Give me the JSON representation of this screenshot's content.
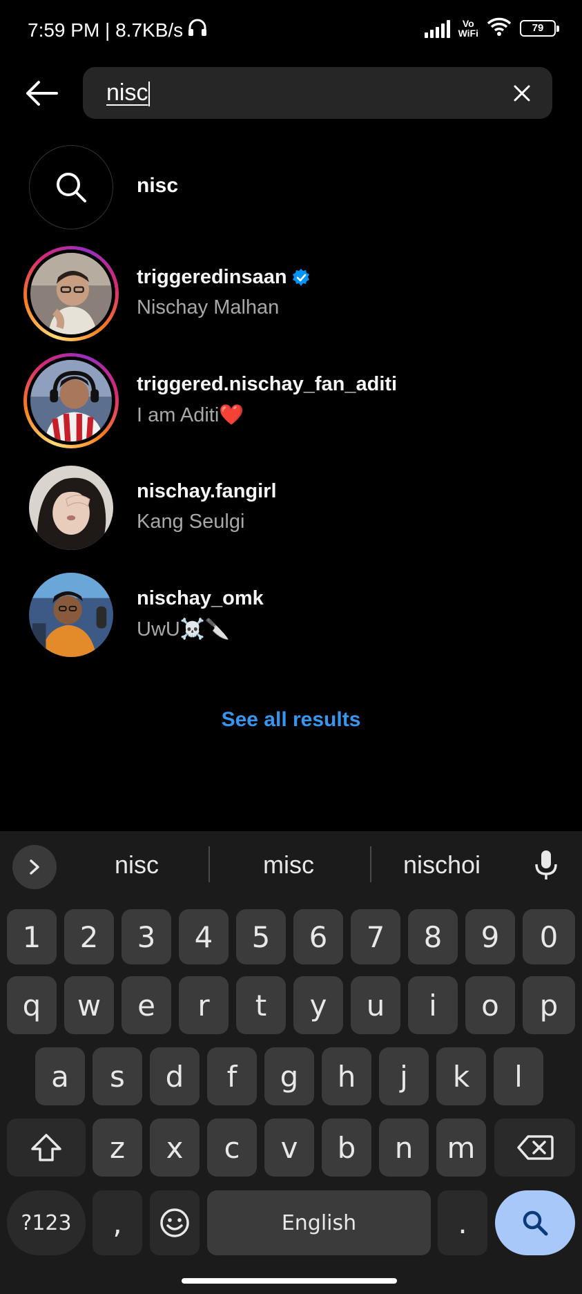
{
  "status_bar": {
    "time_speed": "7:59 PM | 8.7KB/s",
    "vowifi_top": "Vo",
    "vowifi_bottom": "WiFi",
    "battery": "79"
  },
  "search": {
    "value": "nisc"
  },
  "query_row": {
    "text": "nisc"
  },
  "results": [
    {
      "username": "triggeredinsaan",
      "subtitle": "Nischay Malhan",
      "verified": true,
      "story_ring": true
    },
    {
      "username": "triggered.nischay_fan_aditi",
      "subtitle": "I am Aditi❤️",
      "verified": false,
      "story_ring": true
    },
    {
      "username": "nischay.fangirl",
      "subtitle": "Kang Seulgi",
      "verified": false,
      "story_ring": false
    },
    {
      "username": "nischay_omk",
      "subtitle": "UwU☠️🔪",
      "verified": false,
      "story_ring": false
    }
  ],
  "see_all": "See all results",
  "keyboard": {
    "suggestions": [
      "nisc",
      "misc",
      "nischoi"
    ],
    "row_numbers": [
      "1",
      "2",
      "3",
      "4",
      "5",
      "6",
      "7",
      "8",
      "9",
      "0"
    ],
    "row_1": [
      "q",
      "w",
      "e",
      "r",
      "t",
      "y",
      "u",
      "i",
      "o",
      "p"
    ],
    "row_2": [
      "a",
      "s",
      "d",
      "f",
      "g",
      "h",
      "j",
      "k",
      "l"
    ],
    "row_3": [
      "z",
      "x",
      "c",
      "v",
      "b",
      "n",
      "m"
    ],
    "symbols_key": "?123",
    "comma_key": ",",
    "space_label": "English",
    "period_key": "."
  },
  "colors": {
    "background": "#000000",
    "search_field": "#262626",
    "link_blue": "#3797f0",
    "verified_blue": "#0095f6",
    "keyboard_bg": "#1b1b1b",
    "key_bg": "#3b3b3b",
    "search_key_bg": "#a8c8fa"
  }
}
